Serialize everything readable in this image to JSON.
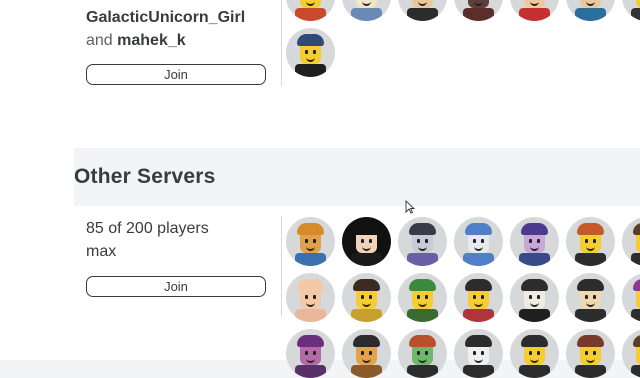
{
  "top_server": {
    "friends_line1": "GalacticUnicorn_Girl",
    "friends_and": "and",
    "friends_line2": "mahek_k",
    "join_label": "Join"
  },
  "other_servers": {
    "heading": "Other Servers",
    "server": {
      "players_text": "85 of 200 players",
      "players_text2": "max",
      "join_label": "Join"
    }
  },
  "avatars_top": [
    {
      "skin": "#f5cd30",
      "hair": "#7a3e1a",
      "shirt": "#c84a2b",
      "bg": "#d6d8da"
    },
    {
      "skin": "#f2e6c8",
      "hair": "#dcd3a0",
      "shirt": "#6a8ab4",
      "bg": "#d6d8da"
    },
    {
      "skin": "#e9c79a",
      "hair": "#3a2b22",
      "shirt": "#2c2c2c",
      "bg": "#d6d8da"
    },
    {
      "skin": "#5a3e3a",
      "hair": "#2a1f1e",
      "shirt": "#5b2e2a",
      "bg": "#d6d8da"
    },
    {
      "skin": "#efc8a0",
      "hair": "#171717",
      "shirt": "#c73030",
      "bg": "#d6d8da"
    },
    {
      "skin": "#e9c79a",
      "hair": "#2d7a46",
      "shirt": "#2a6e9e",
      "bg": "#d6d8da"
    },
    {
      "skin": "#f5cd30",
      "hair": "#2c2c2c",
      "shirt": "#333333",
      "bg": "#d6d8da"
    },
    {
      "skin": "#f5cd30",
      "hair": "#304a78",
      "shirt": "#1f1f1f",
      "bg": "#d6d8da"
    }
  ],
  "avatars_bottom": [
    {
      "skin": "#e1a04a",
      "hair": "#d68b2a",
      "shirt": "#3a6fb0",
      "bg": "#d6d8da"
    },
    {
      "skin": "#f1d4b8",
      "hair": "#121212",
      "shirt": "#1a1a1a",
      "bg": "#111111"
    },
    {
      "skin": "#c9c9d8",
      "hair": "#3a3a4a",
      "shirt": "#6b5ea8",
      "bg": "#d6d8da"
    },
    {
      "skin": "#e8e8f0",
      "hair": "#4f7fc7",
      "shirt": "#4f7fc7",
      "bg": "#d6d8da"
    },
    {
      "skin": "#c7a6d8",
      "hair": "#4c3a8e",
      "shirt": "#394a8a",
      "bg": "#d6d8da"
    },
    {
      "skin": "#f5cd30",
      "hair": "#c45a2a",
      "shirt": "#2c2c2c",
      "bg": "#d6d8da"
    },
    {
      "skin": "#f5cd30",
      "hair": "#5a3e2a",
      "shirt": "#2c2c2c",
      "bg": "#d6d8da"
    },
    {
      "skin": "#f3c9a8",
      "hair": "#f3c9a8",
      "shirt": "#e9b79a",
      "bg": "#d6d8da"
    },
    {
      "skin": "#f5cd30",
      "hair": "#3a2b22",
      "shirt": "#c8a030",
      "bg": "#d6d8da"
    },
    {
      "skin": "#f5cd30",
      "hair": "#3b8a3e",
      "shirt": "#3a6a2e",
      "bg": "#d6d8da"
    },
    {
      "skin": "#f5cd30",
      "hair": "#2c2c2c",
      "shirt": "#b0343a",
      "bg": "#d6d8da"
    },
    {
      "skin": "#f0ebe0",
      "hair": "#2c2c2c",
      "shirt": "#1f1f1f",
      "bg": "#d6d8da"
    },
    {
      "skin": "#f0d8b0",
      "hair": "#2c2c2c",
      "shirt": "#2c2c2c",
      "bg": "#d6d8da"
    },
    {
      "skin": "#f5cd30",
      "hair": "#8b3a8e",
      "shirt": "#2c2c2c",
      "bg": "#d6d8da"
    },
    {
      "skin": "#b46aa8",
      "hair": "#6a2f7a",
      "shirt": "#5a2f6a",
      "bg": "#d6d8da"
    },
    {
      "skin": "#e6a24a",
      "hair": "#2c2c2c",
      "shirt": "#8a5a2a",
      "bg": "#d6d8da"
    },
    {
      "skin": "#6db86a",
      "hair": "#b8502a",
      "shirt": "#2c2c2c",
      "bg": "#d6d8da"
    },
    {
      "skin": "#f0f0f0",
      "hair": "#2c2c2c",
      "shirt": "#2c2c2c",
      "bg": "#d6d8da"
    },
    {
      "skin": "#f5cd30",
      "hair": "#2c2c2c",
      "shirt": "#2c2c2c",
      "bg": "#d6d8da"
    },
    {
      "skin": "#f5cd30",
      "hair": "#7a3a2a",
      "shirt": "#2c2c2c",
      "bg": "#d6d8da"
    },
    {
      "skin": "#f5cd30",
      "hair": "#5a3e2a",
      "shirt": "#2c2c2c",
      "bg": "#d6d8da"
    }
  ]
}
